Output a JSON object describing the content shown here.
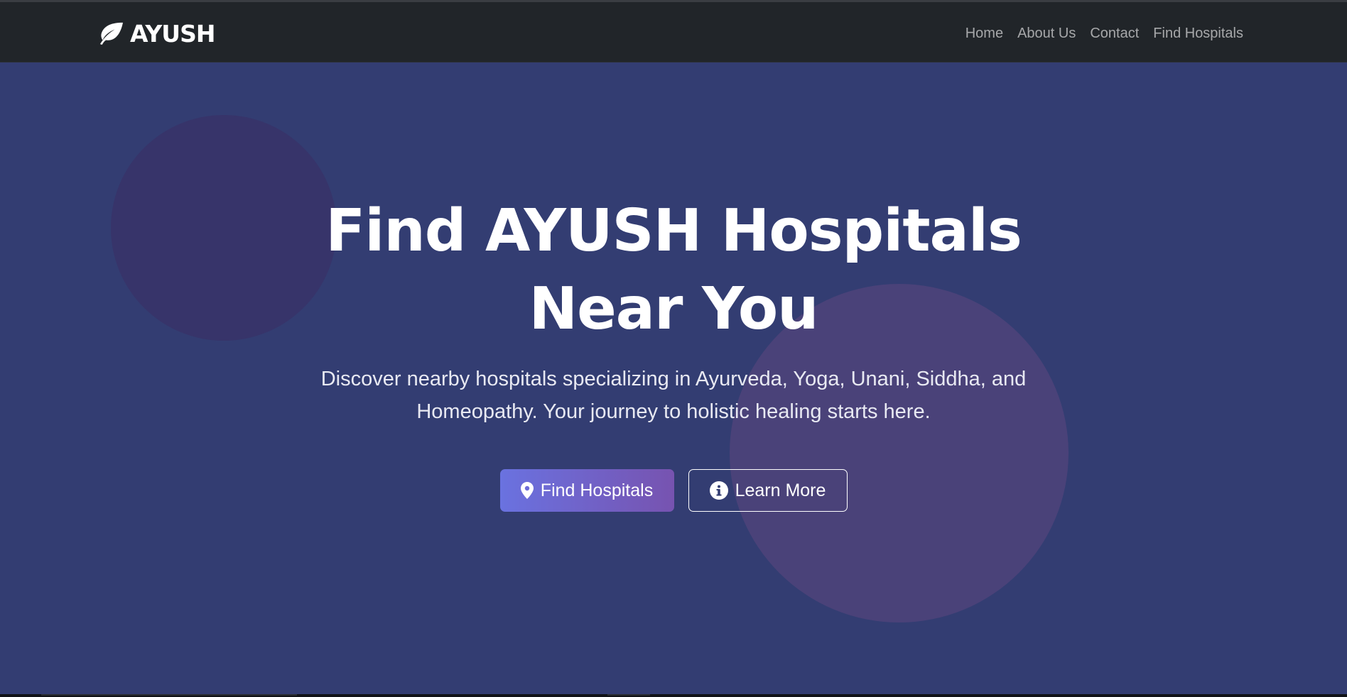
{
  "navbar": {
    "brand": {
      "icon": "leaf-icon",
      "text": "AYUSH"
    },
    "links": [
      {
        "label": "Home"
      },
      {
        "label": "About Us"
      },
      {
        "label": "Contact"
      },
      {
        "label": "Find Hospitals"
      }
    ]
  },
  "hero": {
    "title_line1": "Find AYUSH Hospitals",
    "title_line2": "Near You",
    "subtitle_line1": "Discover nearby hospitals specializing in Ayurveda, Yoga, Unani, Siddha, and",
    "subtitle_line2": "Homeopathy. Your journey to holistic healing starts here.",
    "primary_button": {
      "icon": "map-pin-icon",
      "label": "Find Hospitals"
    },
    "secondary_button": {
      "icon": "info-circle-icon",
      "label": "Learn More"
    }
  },
  "colors": {
    "navbar_bg": "#212529",
    "hero_bg": "#333d72",
    "button_gradient_start": "#6a72e0",
    "button_gradient_end": "#7753b0"
  }
}
